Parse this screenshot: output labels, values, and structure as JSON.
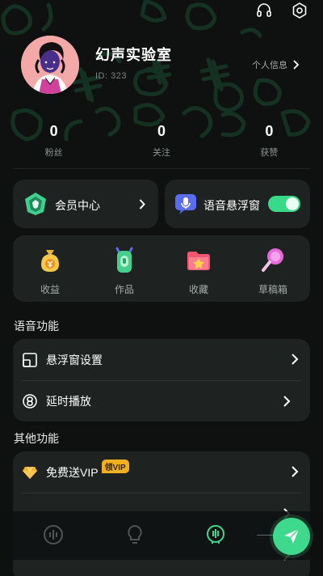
{
  "header": {
    "icons": [
      "headset-icon",
      "settings-icon"
    ]
  },
  "profile": {
    "name": "幻声实验室",
    "id_text": "ID: 323",
    "info_link": "个人信息"
  },
  "stats": [
    {
      "value": "0",
      "label": "粉丝"
    },
    {
      "value": "0",
      "label": "关注"
    },
    {
      "value": "0",
      "label": "获赞"
    }
  ],
  "member_center": {
    "label": "会员中心",
    "icon": "gem-shield-icon"
  },
  "voice_float": {
    "label": "语音悬浮窗",
    "icon": "microphone-icon",
    "toggle_on": true
  },
  "shortcuts": [
    {
      "label": "收益",
      "icon": "money-bag-icon"
    },
    {
      "label": "作品",
      "icon": "phone-works-icon"
    },
    {
      "label": "收藏",
      "icon": "star-folder-icon"
    },
    {
      "label": "草稿箱",
      "icon": "lollipop-mic-icon"
    }
  ],
  "voice_section": {
    "title": "语音功能",
    "items": [
      {
        "label": "悬浮窗设置",
        "icon": "float-window-icon"
      },
      {
        "label": "延时播放",
        "icon": "delay-play-icon"
      }
    ]
  },
  "other_section": {
    "title": "其他功能",
    "items": [
      {
        "label": "免费送VIP",
        "badge": "领VIP",
        "icon": "gold-diamond-icon"
      }
    ]
  },
  "bottom_nav": [
    {
      "icon": "soundwave-icon"
    },
    {
      "icon": "bulb-icon"
    },
    {
      "icon": "mic-circle-icon",
      "active": true
    }
  ],
  "fab": {
    "icon": "send-icon"
  },
  "colors": {
    "accent": "#3ed98c",
    "card": "#1e2321",
    "badge": "#f2b01e"
  }
}
